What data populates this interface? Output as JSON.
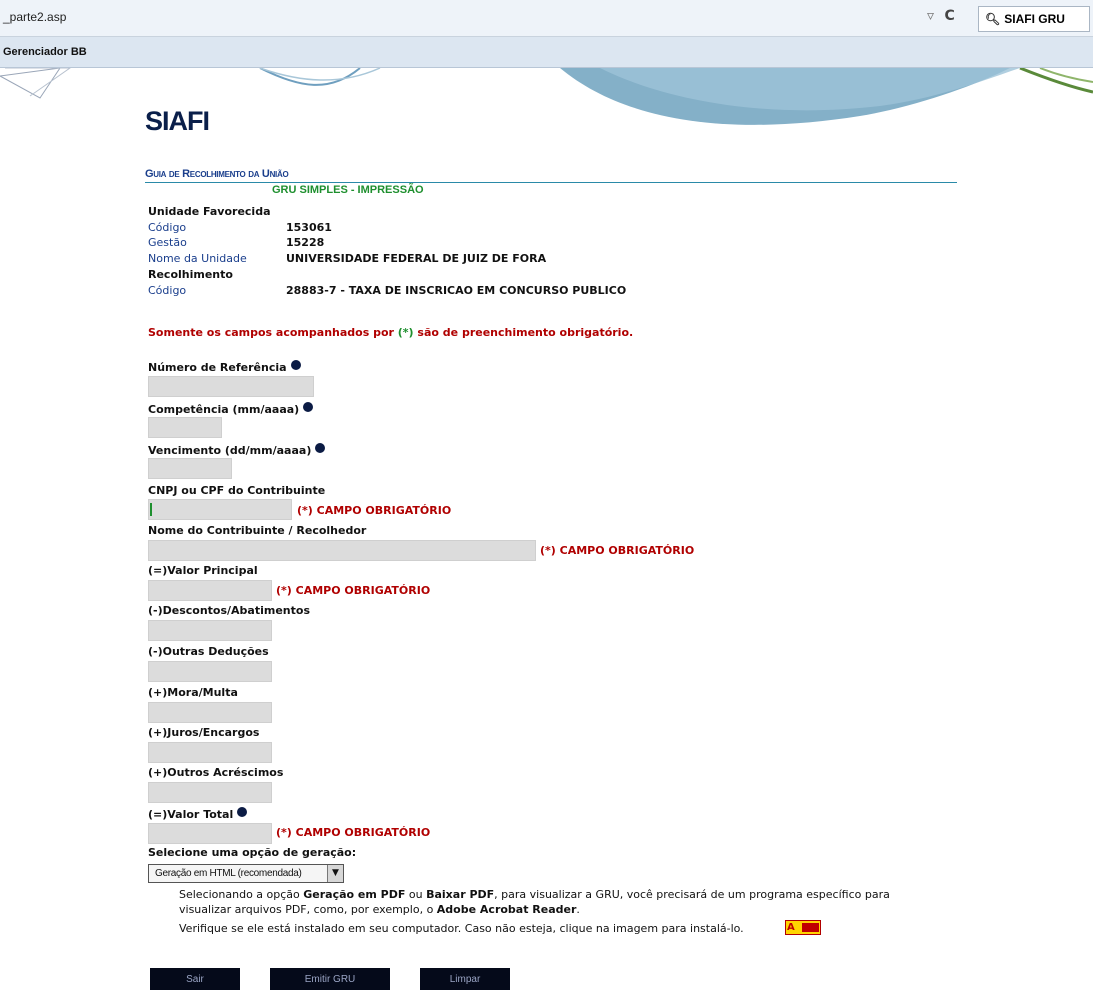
{
  "browser": {
    "url": "_parte2.asp",
    "search_text": "SIAFI GRU",
    "bookmark": "Gerenciador BB"
  },
  "header": {
    "logo": "SIAFI",
    "title": "Guia de Recolhimento da União",
    "subtitle": "GRU SIMPLES - IMPRESSÃO"
  },
  "unidade": {
    "heading": "Unidade Favorecida",
    "codigo_label": "Código",
    "codigo": "153061",
    "gestao_label": "Gestão",
    "gestao": "15228",
    "nome_label": "Nome da Unidade",
    "nome": "UNIVERSIDADE FEDERAL DE JUIZ DE FORA"
  },
  "recolhimento": {
    "heading": "Recolhimento",
    "codigo_label": "Código",
    "codigo": "28883-7 - TAXA DE INSCRICAO EM CONCURSO PUBLICO"
  },
  "notice": {
    "before": "Somente os campos acompanhados por ",
    "ast": "(*)",
    "after": " são de preenchimento obrigatório."
  },
  "required_label": "(*) CAMPO OBRIGATÓRIO",
  "fields": {
    "numero_referencia": "Número de Referência",
    "competencia": "Competência (mm/aaaa)",
    "vencimento": "Vencimento (dd/mm/aaaa)",
    "cnpj_cpf": "CNPJ ou CPF do Contribuinte",
    "nome_contribuinte": "Nome do Contribuinte / Recolhedor",
    "valor_principal": "(=)Valor Principal",
    "descontos": "(-)Descontos/Abatimentos",
    "outras_deducoes": "(-)Outras Deduções",
    "mora_multa": "(+)Mora/Multa",
    "juros_encargos": "(+)Juros/Encargos",
    "outros_acrescimos": "(+)Outros Acréscimos",
    "valor_total": "(=)Valor Total"
  },
  "geracao": {
    "label": "Selecione uma opção de geração:",
    "selected": "Geração em HTML (recomendada)"
  },
  "info": {
    "line1_a": "Selecionando a opção ",
    "line1_b": "Geração em PDF",
    "line1_c": " ou ",
    "line1_d": "Baixar PDF",
    "line1_e": ", para visualizar a GRU, você precisará de um programa específico para",
    "line2_a": "visualizar arquivos PDF, como, por exemplo, o ",
    "line2_b": "Adobe Acrobat Reader",
    "line2_c": ".",
    "line3": "Verifique se ele está instalado em seu computador. Caso não esteja, clique na imagem para instalá-lo."
  },
  "buttons": {
    "sair": "Sair",
    "emitir": "Emitir GRU",
    "limpar": "Limpar"
  },
  "colors": {
    "navy": "#0a1f4a",
    "required_red": "#b00000",
    "green": "#1e8f2e",
    "field_gray": "#dcdcdc"
  }
}
